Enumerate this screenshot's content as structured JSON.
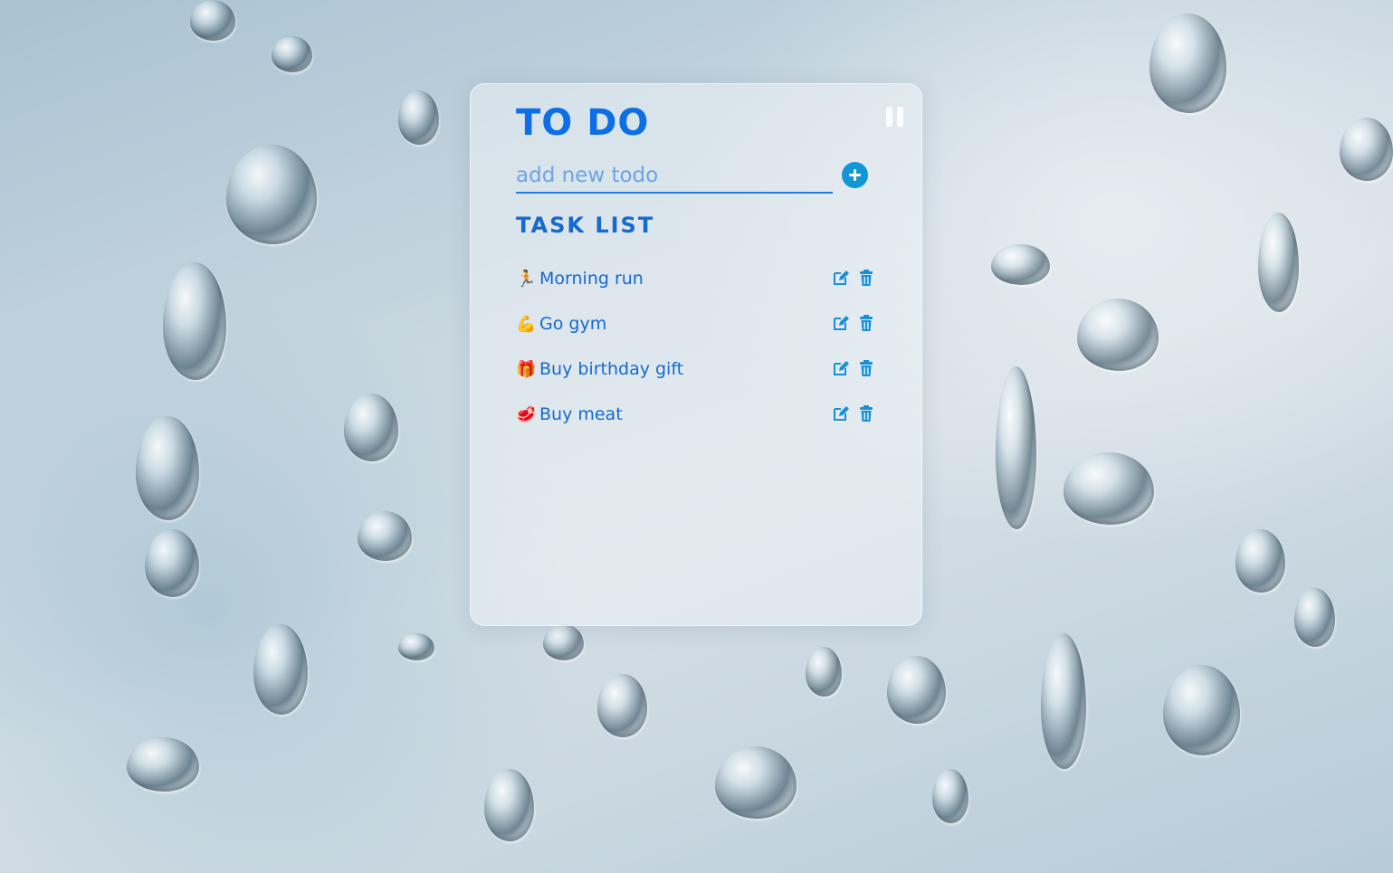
{
  "app": {
    "title": "TO DO"
  },
  "new_todo": {
    "placeholder": "add new todo",
    "value": ""
  },
  "task_list": {
    "heading": "TASK LIST",
    "tasks": [
      {
        "emoji": "🏃",
        "label": "Morning run"
      },
      {
        "emoji": "💪",
        "label": "Go gym"
      },
      {
        "emoji": "🎁",
        "label": "Buy birthday gift"
      },
      {
        "emoji": "🥩",
        "label": "Buy meat"
      }
    ]
  },
  "icons": {
    "pause": "pause-icon",
    "add": "plus-circle-icon",
    "edit": "edit-icon",
    "delete": "trash-icon"
  },
  "colors": {
    "title": "#0d6fe6",
    "text": "#1669cf",
    "accent": "#1196d6",
    "icon": "#1a8fd6"
  }
}
